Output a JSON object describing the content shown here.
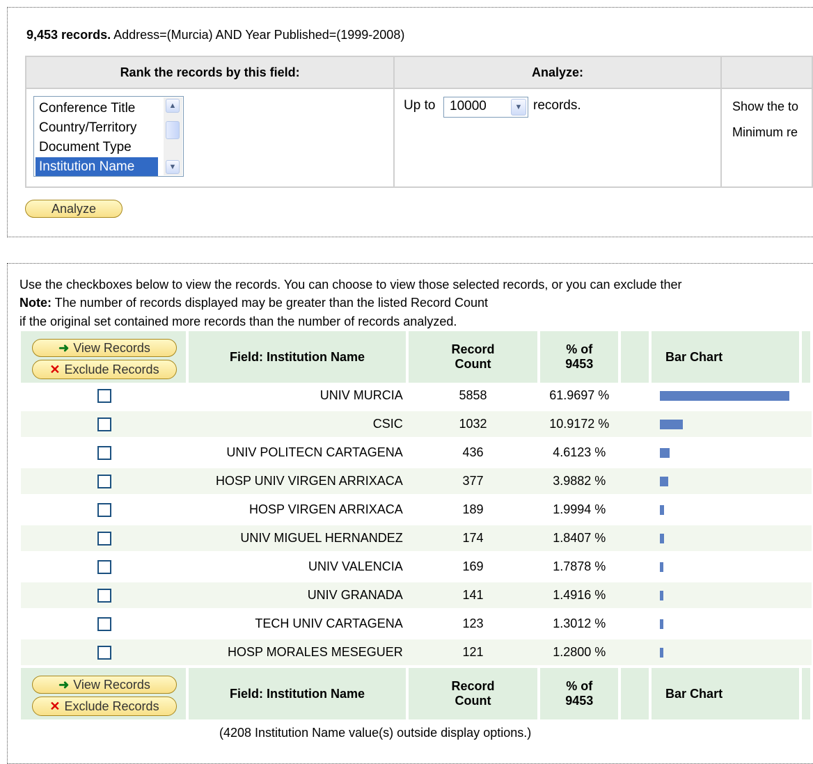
{
  "summary": {
    "count": "9,453 records.",
    "query": " Address=(Murcia) AND Year Published=(1999-2008)"
  },
  "controls": {
    "rank_header": "Rank the records by this field:",
    "analyze_header": "Analyze:",
    "fields": [
      "Conference Title",
      "Country/Territory",
      "Document Type",
      "Institution Name"
    ],
    "selected_field": "Institution Name",
    "up_to": "Up to",
    "limit_value": "10000",
    "records_label": "records.",
    "show_the_top": "Show the to",
    "minimum_record": "Minimum re",
    "analyze_button": "Analyze"
  },
  "info": {
    "line1": "Use the checkboxes below to view the records. You can choose to view those selected records, or you can exclude ther",
    "note_label": "Note:",
    "line2": " The number of records displayed may be greater than the listed Record Count",
    "line3": "if the original set contained more records than the number of records analyzed."
  },
  "table": {
    "view_records": "View Records",
    "exclude_records": "Exclude Records",
    "col_field": "Field: Institution Name",
    "col_count_1": "Record",
    "col_count_2": "Count",
    "col_pct_1": "% of",
    "col_pct_2": "9453",
    "col_chart": "Bar Chart",
    "rows": [
      {
        "name": "UNIV MURCIA",
        "count": "5858",
        "pct": "61.9697 %",
        "fraction": 0.619697
      },
      {
        "name": "CSIC",
        "count": "1032",
        "pct": "10.9172 %",
        "fraction": 0.109172
      },
      {
        "name": "UNIV POLITECN CARTAGENA",
        "count": "436",
        "pct": "4.6123 %",
        "fraction": 0.046123
      },
      {
        "name": "HOSP UNIV VIRGEN ARRIXACA",
        "count": "377",
        "pct": "3.9882 %",
        "fraction": 0.039882
      },
      {
        "name": "HOSP VIRGEN ARRIXACA",
        "count": "189",
        "pct": "1.9994 %",
        "fraction": 0.019994
      },
      {
        "name": "UNIV MIGUEL HERNANDEZ",
        "count": "174",
        "pct": "1.8407 %",
        "fraction": 0.018407
      },
      {
        "name": "UNIV VALENCIA",
        "count": "169",
        "pct": "1.7878 %",
        "fraction": 0.017878
      },
      {
        "name": "UNIV GRANADA",
        "count": "141",
        "pct": "1.4916 %",
        "fraction": 0.014916
      },
      {
        "name": "TECH UNIV CARTAGENA",
        "count": "123",
        "pct": "1.3012 %",
        "fraction": 0.013012
      },
      {
        "name": "HOSP MORALES MESEGUER",
        "count": "121",
        "pct": "1.2800 %",
        "fraction": 0.0128
      }
    ],
    "footnote": "(4208 Institution Name value(s) outside display options.)"
  },
  "colors": {
    "bar": "#5b7fc2",
    "header_bg": "#e0efe0",
    "alt_row": "#f2f7ee",
    "selected": "#316ac5"
  }
}
